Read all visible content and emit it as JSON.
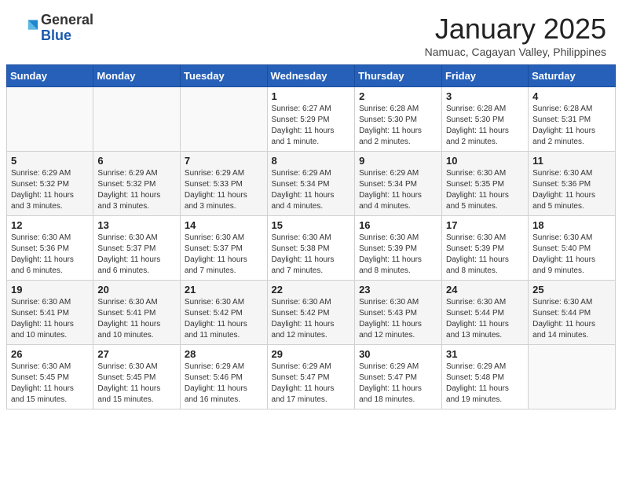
{
  "header": {
    "logo_general": "General",
    "logo_blue": "Blue",
    "month_title": "January 2025",
    "subtitle": "Namuac, Cagayan Valley, Philippines"
  },
  "weekdays": [
    "Sunday",
    "Monday",
    "Tuesday",
    "Wednesday",
    "Thursday",
    "Friday",
    "Saturday"
  ],
  "weeks": [
    [
      {
        "day": "",
        "info": ""
      },
      {
        "day": "",
        "info": ""
      },
      {
        "day": "",
        "info": ""
      },
      {
        "day": "1",
        "info": "Sunrise: 6:27 AM\nSunset: 5:29 PM\nDaylight: 11 hours\nand 1 minute."
      },
      {
        "day": "2",
        "info": "Sunrise: 6:28 AM\nSunset: 5:30 PM\nDaylight: 11 hours\nand 2 minutes."
      },
      {
        "day": "3",
        "info": "Sunrise: 6:28 AM\nSunset: 5:30 PM\nDaylight: 11 hours\nand 2 minutes."
      },
      {
        "day": "4",
        "info": "Sunrise: 6:28 AM\nSunset: 5:31 PM\nDaylight: 11 hours\nand 2 minutes."
      }
    ],
    [
      {
        "day": "5",
        "info": "Sunrise: 6:29 AM\nSunset: 5:32 PM\nDaylight: 11 hours\nand 3 minutes."
      },
      {
        "day": "6",
        "info": "Sunrise: 6:29 AM\nSunset: 5:32 PM\nDaylight: 11 hours\nand 3 minutes."
      },
      {
        "day": "7",
        "info": "Sunrise: 6:29 AM\nSunset: 5:33 PM\nDaylight: 11 hours\nand 3 minutes."
      },
      {
        "day": "8",
        "info": "Sunrise: 6:29 AM\nSunset: 5:34 PM\nDaylight: 11 hours\nand 4 minutes."
      },
      {
        "day": "9",
        "info": "Sunrise: 6:29 AM\nSunset: 5:34 PM\nDaylight: 11 hours\nand 4 minutes."
      },
      {
        "day": "10",
        "info": "Sunrise: 6:30 AM\nSunset: 5:35 PM\nDaylight: 11 hours\nand 5 minutes."
      },
      {
        "day": "11",
        "info": "Sunrise: 6:30 AM\nSunset: 5:36 PM\nDaylight: 11 hours\nand 5 minutes."
      }
    ],
    [
      {
        "day": "12",
        "info": "Sunrise: 6:30 AM\nSunset: 5:36 PM\nDaylight: 11 hours\nand 6 minutes."
      },
      {
        "day": "13",
        "info": "Sunrise: 6:30 AM\nSunset: 5:37 PM\nDaylight: 11 hours\nand 6 minutes."
      },
      {
        "day": "14",
        "info": "Sunrise: 6:30 AM\nSunset: 5:37 PM\nDaylight: 11 hours\nand 7 minutes."
      },
      {
        "day": "15",
        "info": "Sunrise: 6:30 AM\nSunset: 5:38 PM\nDaylight: 11 hours\nand 7 minutes."
      },
      {
        "day": "16",
        "info": "Sunrise: 6:30 AM\nSunset: 5:39 PM\nDaylight: 11 hours\nand 8 minutes."
      },
      {
        "day": "17",
        "info": "Sunrise: 6:30 AM\nSunset: 5:39 PM\nDaylight: 11 hours\nand 8 minutes."
      },
      {
        "day": "18",
        "info": "Sunrise: 6:30 AM\nSunset: 5:40 PM\nDaylight: 11 hours\nand 9 minutes."
      }
    ],
    [
      {
        "day": "19",
        "info": "Sunrise: 6:30 AM\nSunset: 5:41 PM\nDaylight: 11 hours\nand 10 minutes."
      },
      {
        "day": "20",
        "info": "Sunrise: 6:30 AM\nSunset: 5:41 PM\nDaylight: 11 hours\nand 10 minutes."
      },
      {
        "day": "21",
        "info": "Sunrise: 6:30 AM\nSunset: 5:42 PM\nDaylight: 11 hours\nand 11 minutes."
      },
      {
        "day": "22",
        "info": "Sunrise: 6:30 AM\nSunset: 5:42 PM\nDaylight: 11 hours\nand 12 minutes."
      },
      {
        "day": "23",
        "info": "Sunrise: 6:30 AM\nSunset: 5:43 PM\nDaylight: 11 hours\nand 12 minutes."
      },
      {
        "day": "24",
        "info": "Sunrise: 6:30 AM\nSunset: 5:44 PM\nDaylight: 11 hours\nand 13 minutes."
      },
      {
        "day": "25",
        "info": "Sunrise: 6:30 AM\nSunset: 5:44 PM\nDaylight: 11 hours\nand 14 minutes."
      }
    ],
    [
      {
        "day": "26",
        "info": "Sunrise: 6:30 AM\nSunset: 5:45 PM\nDaylight: 11 hours\nand 15 minutes."
      },
      {
        "day": "27",
        "info": "Sunrise: 6:30 AM\nSunset: 5:45 PM\nDaylight: 11 hours\nand 15 minutes."
      },
      {
        "day": "28",
        "info": "Sunrise: 6:29 AM\nSunset: 5:46 PM\nDaylight: 11 hours\nand 16 minutes."
      },
      {
        "day": "29",
        "info": "Sunrise: 6:29 AM\nSunset: 5:47 PM\nDaylight: 11 hours\nand 17 minutes."
      },
      {
        "day": "30",
        "info": "Sunrise: 6:29 AM\nSunset: 5:47 PM\nDaylight: 11 hours\nand 18 minutes."
      },
      {
        "day": "31",
        "info": "Sunrise: 6:29 AM\nSunset: 5:48 PM\nDaylight: 11 hours\nand 19 minutes."
      },
      {
        "day": "",
        "info": ""
      }
    ]
  ]
}
